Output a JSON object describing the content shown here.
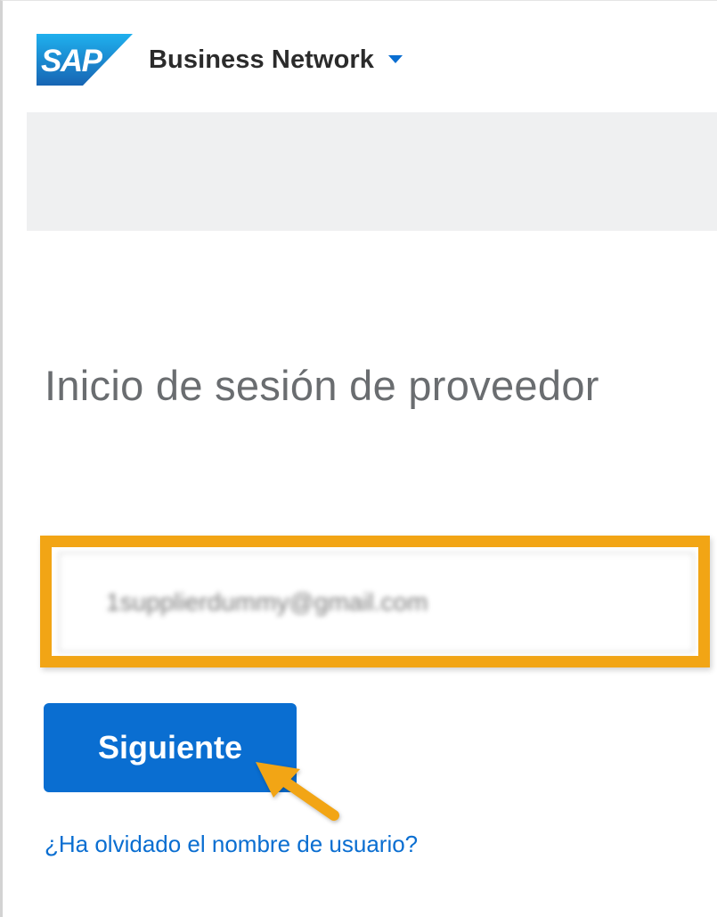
{
  "header": {
    "logo_text": "SAP",
    "product_name": "Business Network"
  },
  "login": {
    "title": "Inicio de sesión de proveedor",
    "username_value": "1supplierdummy@gmail.com",
    "next_label": "Siguiente",
    "forgot_username_label": "¿Ha olvidado el nombre de usuario?"
  },
  "colors": {
    "sap_blue": "#0a6ed1",
    "highlight": "#f2a515",
    "banner_bg": "#eff0f1",
    "title_text": "#6a6d70"
  },
  "icons": {
    "logo": "sap-logo",
    "caret": "caret-down-icon",
    "annotation": "annotation-arrow-icon"
  }
}
